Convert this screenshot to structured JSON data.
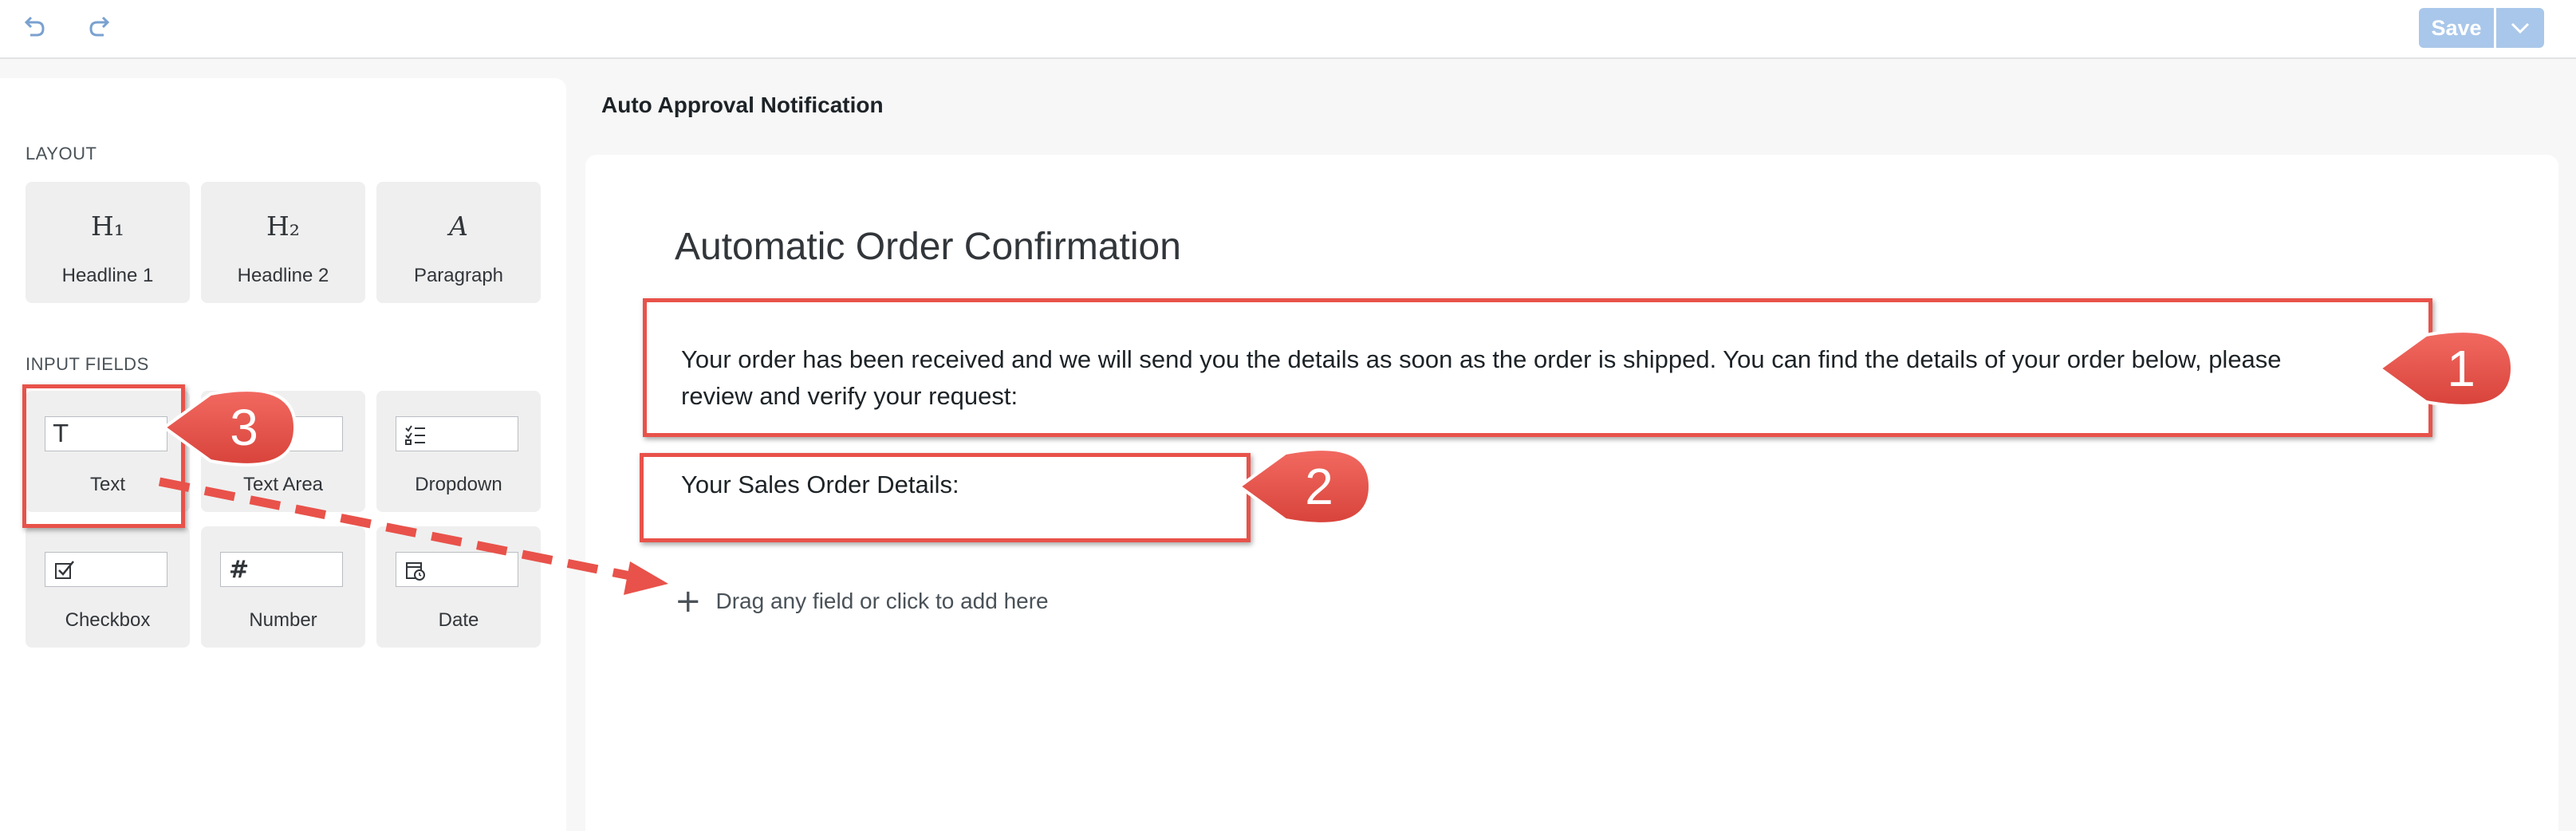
{
  "toolbar": {
    "undo_icon": "undo-icon",
    "redo_icon": "redo-icon",
    "save_label": "Save",
    "save_split_icon": "chevron-down-icon",
    "accent": "#a9c7ea"
  },
  "palette": {
    "layout_title": "LAYOUT",
    "layout_items": [
      {
        "glyph": "H₁",
        "label": "Headline 1"
      },
      {
        "glyph": "H₂",
        "label": "Headline 2"
      },
      {
        "glyph": "A",
        "label": "Paragraph"
      }
    ],
    "input_title": "INPUT FIELDS",
    "input_items": [
      {
        "glyph": "T",
        "label": "Text"
      },
      {
        "glyph": "",
        "label": "Text Area"
      },
      {
        "glyph": "",
        "label": "Dropdown"
      },
      {
        "glyph": "",
        "label": "Checkbox"
      },
      {
        "glyph": "#",
        "label": "Number"
      },
      {
        "glyph": "",
        "label": "Date"
      }
    ]
  },
  "form": {
    "name": "Auto Approval Notification",
    "headline": "Automatic Order Confirmation",
    "paragraph": "Your order has been received and we will send you the details as soon as the order is shipped. You can find the details of your order below, please review and verify your request:",
    "subheading": "Your Sales Order Details:",
    "add_prompt": "Drag any field or click to add here"
  },
  "annotations": {
    "color": "#e8524a",
    "callouts": [
      "1",
      "2",
      "3"
    ]
  }
}
